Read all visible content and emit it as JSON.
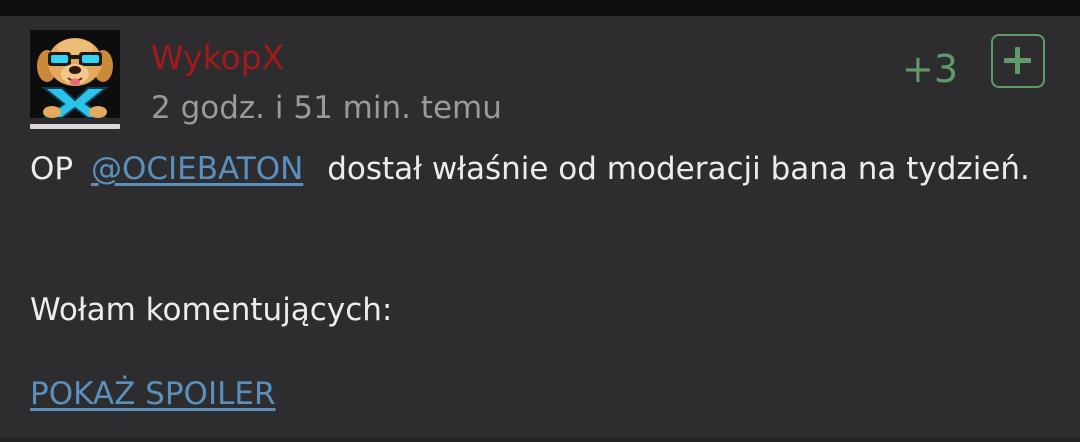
{
  "comment": {
    "author": "WykopX",
    "timestamp": "2 godz. i 51 min. temu",
    "vote_count": "+3",
    "body_prefix": "OP",
    "mention": "@OCIEBATON",
    "body_suffix": "dostał właśnie od moderacji bana na tydzień.",
    "call_line": "Wołam komentujących:",
    "spoiler_link": "POKAŻ SPOILER"
  },
  "icons": {
    "avatar": "dog-with-sunglasses-avatar",
    "upvote": "plus-icon"
  },
  "colors": {
    "author": "#a21a1a",
    "vote": "#5f9a68",
    "link": "#5a90bb",
    "text": "#ececee",
    "muted": "#9a9a9d",
    "background": "#2d2d30"
  }
}
